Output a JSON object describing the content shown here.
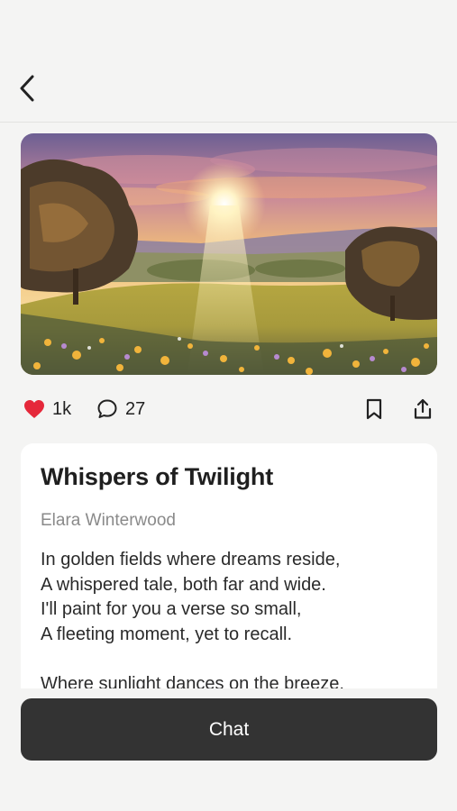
{
  "header": {
    "back_icon": "chevron-left-icon"
  },
  "hero": {
    "image_subject": "sunset-meadow-painting"
  },
  "actions": {
    "likes": "1k",
    "comments": "27",
    "like_color": "#e5283a",
    "icons": [
      "heart-icon",
      "comment-icon",
      "bookmark-icon",
      "share-icon"
    ]
  },
  "poem": {
    "title": "Whispers of Twilight",
    "author": "Elara Winterwood",
    "stanzas": [
      [
        "In golden fields where dreams reside,",
        "A whispered tale, both far and wide.",
        "I'll paint for you a verse so small,",
        "A fleeting moment, yet to recall."
      ],
      [
        "Where sunlight dances on the breeze,"
      ]
    ]
  },
  "chat_button": {
    "label": "Chat",
    "background": "#333333"
  }
}
